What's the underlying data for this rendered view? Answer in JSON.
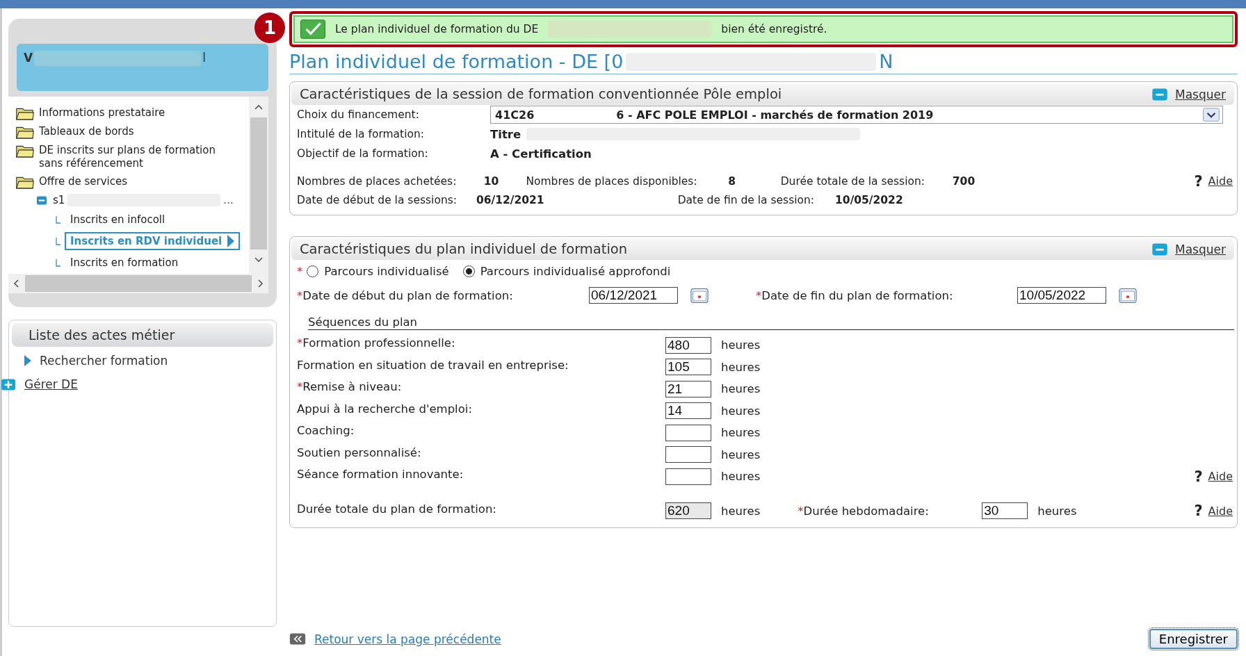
{
  "sidebar": {
    "user": {
      "initial": "V",
      "suffix": "l"
    },
    "tree": [
      {
        "label": "Informations prestataire",
        "kind": "folder",
        "selected": false
      },
      {
        "label": "Tableaux de bords",
        "kind": "folder",
        "selected": false
      },
      {
        "label": "DE inscrits sur plans de formation sans référencement",
        "kind": "folder",
        "selected": false
      },
      {
        "label": "Offre de services",
        "kind": "folder",
        "selected": false,
        "children": [
          {
            "label": "s1",
            "trail": "...",
            "expanded": true,
            "selected": false,
            "children": [
              {
                "label": "Inscrits en infocoll",
                "selected": false
              },
              {
                "label": "Inscrits en RDV individuel",
                "selected": true
              },
              {
                "label": "Inscrits en formation",
                "selected": false
              }
            ]
          }
        ]
      }
    ],
    "actions": {
      "title": "Liste des actes métier",
      "items": [
        {
          "label": "Rechercher formation",
          "kind": "arrow"
        },
        {
          "label": "Gérer DE",
          "kind": "plus"
        }
      ]
    }
  },
  "callout": "1",
  "message": {
    "before": "Le plan individuel de formation du DE",
    "after": "bien été enregistré."
  },
  "title": {
    "start": "Plan individuel de formation - DE [0",
    "end": "N"
  },
  "session": {
    "title": "Caractéristiques de la session de formation conventionnée Pôle emploi",
    "toggle": "Masquer",
    "financement_label": "Choix du financement:",
    "financement": {
      "start": "41C26",
      "end": "6 - AFC POLE EMPLOI  - marchés de formation 2019"
    },
    "intitule_label": "Intitulé de la formation:",
    "intitule": "Titre",
    "objectif_label": "Objectif de la formation:",
    "objectif": "A - Certification",
    "stats": [
      {
        "label": "Nombres de places achetées:",
        "value": "10"
      },
      {
        "label": "Nombres de places disponibles:",
        "value": "8"
      },
      {
        "label": "Durée totale de la session:",
        "value": "700"
      }
    ],
    "help": {
      "icon": "?",
      "label": "Aide"
    },
    "dates": [
      {
        "label": "Date de début de la sessions:",
        "value": "06/12/2021"
      },
      {
        "label": "Date de fin de la session:",
        "value": "10/05/2022"
      }
    ]
  },
  "plan": {
    "required_mark": "*",
    "title": "Caractéristiques du plan individuel de formation",
    "toggle": "Masquer",
    "parcours": [
      {
        "label": "Parcours individualisé",
        "selected": false
      },
      {
        "label": "Parcours individualisé approfondi",
        "selected": true
      }
    ],
    "dates": [
      {
        "label": "Date de début du plan de formation:",
        "value": "06/12/2021"
      },
      {
        "label": "Date de fin du plan de formation:",
        "value": "10/05/2022"
      }
    ],
    "sequences_title": "Séquences du plan",
    "sequences": [
      {
        "label": "Formation professionnelle:",
        "required": true,
        "value": "480",
        "unit": "heures"
      },
      {
        "label": "Formation en situation de travail en entreprise:",
        "required": false,
        "value": "105",
        "unit": "heures"
      },
      {
        "label": "Remise à niveau:",
        "required": true,
        "value": "21",
        "unit": "heures"
      },
      {
        "label": "Appui à la recherche d'emploi:",
        "required": false,
        "value": "14",
        "unit": "heures"
      },
      {
        "label": "Coaching:",
        "required": false,
        "unit": "heures"
      },
      {
        "label": "Soutien personnalisé:",
        "required": false,
        "unit": "heures"
      },
      {
        "label": "Séance formation innovante:",
        "required": false,
        "unit": "heures",
        "help": {
          "icon": "?",
          "label": "Aide"
        }
      }
    ],
    "total": {
      "label": "Durée totale du plan de formation:",
      "value": "620",
      "unit": "heures"
    },
    "weekly": {
      "label": "Durée hebdomadaire:",
      "value": "30",
      "unit": "heures",
      "help": {
        "icon": "?",
        "label": "Aide"
      }
    }
  },
  "footer": {
    "back": "Retour vers la page précédente",
    "save": "Enregistrer"
  }
}
